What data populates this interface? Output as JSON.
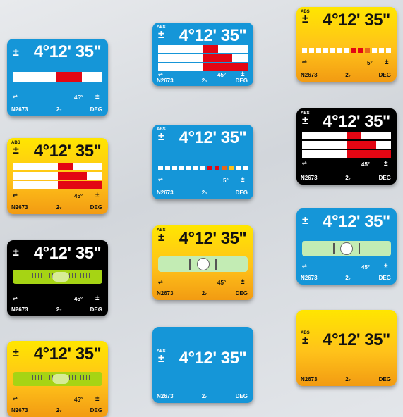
{
  "display": {
    "abs": "ABS",
    "plus_minus": "±",
    "angle": "4°12' 35\"",
    "arrow": "⇌",
    "angle_45": "45°",
    "angle_5": "5°",
    "tol": "±",
    "serial": "N2673",
    "mode": "2₇",
    "unit": "DEG"
  },
  "colors": {
    "blue": "#1596d8",
    "black": "#000000",
    "orange": "#ffc21a",
    "red_bar": "#e30613",
    "vial_green": "#c3ecb4",
    "vial_lime": "#a6d414"
  },
  "cards": [
    {
      "theme": "blue",
      "visual": "single-bar"
    },
    {
      "theme": "orange",
      "visual": "histogram"
    },
    {
      "theme": "black",
      "visual": "vial"
    },
    {
      "theme": "orange",
      "visual": "vial"
    },
    {
      "theme": "blue",
      "visual": "histogram"
    },
    {
      "theme": "blue",
      "visual": "dots"
    },
    {
      "theme": "orange",
      "visual": "bubble-vial"
    },
    {
      "theme": "blue",
      "visual": "none"
    },
    {
      "theme": "orange",
      "visual": "dots"
    },
    {
      "theme": "black",
      "visual": "histogram"
    },
    {
      "theme": "blue",
      "visual": "bubble-vial"
    },
    {
      "theme": "orange",
      "visual": "none"
    }
  ]
}
